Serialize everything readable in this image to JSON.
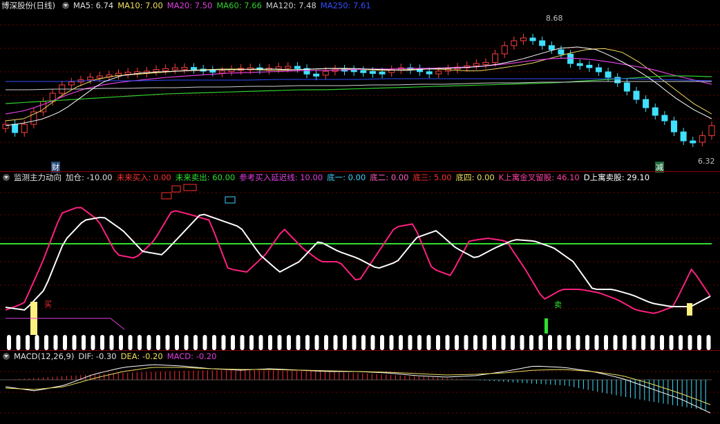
{
  "main": {
    "title": "博深股份(日线)",
    "ma": [
      {
        "label": "MA5: 6.74",
        "color": "#e0e0e0"
      },
      {
        "label": "MA10: 7.00",
        "color": "#f0e060"
      },
      {
        "label": "MA20: 7.50",
        "color": "#e040e0"
      },
      {
        "label": "MA60: 7.66",
        "color": "#30d030"
      },
      {
        "label": "MA120: 7.48",
        "color": "#d0d0d0"
      },
      {
        "label": "MA250: 7.61",
        "color": "#3050ff"
      }
    ],
    "high_label": "8.68",
    "low_label": "6.32",
    "tag_cai": "财",
    "tag_jian": "减"
  },
  "indicator": {
    "title": "监测主力动向",
    "items": [
      {
        "label": "加仓: -10.00",
        "color": "#e0e0e0"
      },
      {
        "label": "未来买入: 0.00",
        "color": "#ff3030"
      },
      {
        "label": "未来卖出: 60.00",
        "color": "#30e030"
      },
      {
        "label": "参考买入延迟线: 10.00",
        "color": "#e040e0"
      },
      {
        "label": "底一: 0.00",
        "color": "#40d0ff"
      },
      {
        "label": "底二: 0.00",
        "color": "#ff60c0"
      },
      {
        "label": "底三: 5.00",
        "color": "#ff3030"
      },
      {
        "label": "底四: 0.00",
        "color": "#f0e060"
      },
      {
        "label": "K上寓金叉留股: 46.10",
        "color": "#ff40a0"
      },
      {
        "label": "D上寓卖股: 29.10",
        "color": "#ffffff"
      }
    ],
    "buy_label": "买",
    "sell_label": "卖"
  },
  "macd": {
    "title": "MACD(12,26,9)",
    "items": [
      {
        "label": "DIF: -0.30",
        "color": "#e0e0e0"
      },
      {
        "label": "DEA: -0.20",
        "color": "#f0e060"
      },
      {
        "label": "MACD: -0.20",
        "color": "#e040e0"
      }
    ]
  }
}
